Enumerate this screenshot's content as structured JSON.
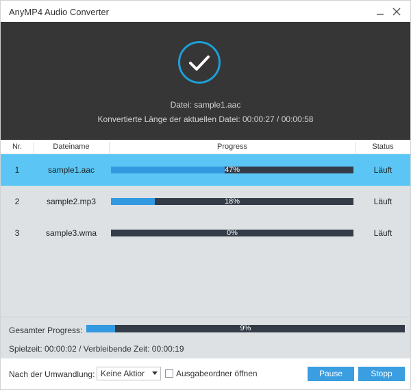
{
  "window": {
    "title": "AnyMP4 Audio Converter"
  },
  "header": {
    "file_line": "Datei: sample1.aac",
    "length_line": "Konvertierte Länge der aktuellen Datei: 00:00:27 / 00:00:58",
    "status_icon": "checkmark-circle-icon",
    "accent_color": "#1e9fd8"
  },
  "table": {
    "columns": [
      "Nr.",
      "Dateiname",
      "Progress",
      "Status"
    ],
    "rows": [
      {
        "nr": "1",
        "name": "sample1.aac",
        "progress": 47,
        "progress_text": "47%",
        "status": "Läuft",
        "selected": true
      },
      {
        "nr": "2",
        "name": "sample2.mp3",
        "progress": 18,
        "progress_text": "18%",
        "status": "Läuft",
        "selected": false
      },
      {
        "nr": "3",
        "name": "sample3.wma",
        "progress": 0,
        "progress_text": "0%",
        "status": "Läuft",
        "selected": false
      }
    ]
  },
  "footer": {
    "total_label": "Gesamter Progress:",
    "total_progress": 9,
    "total_progress_text": "9%",
    "time_line": "Spielzeit: 00:00:02 / Verbleibende Zeit: 00:00:19"
  },
  "toolbar": {
    "after_label": "Nach der Umwandlung:",
    "after_selected": "Keine Aktior",
    "open_folder_label": "Ausgabeordner öffnen",
    "open_folder_checked": false,
    "pause_label": "Pause",
    "stop_label": "Stopp"
  },
  "colors": {
    "selected_row": "#5bc6f5",
    "progress_fill": "#3399e0",
    "progress_track": "#343c48",
    "button": "#3a9ee0"
  }
}
